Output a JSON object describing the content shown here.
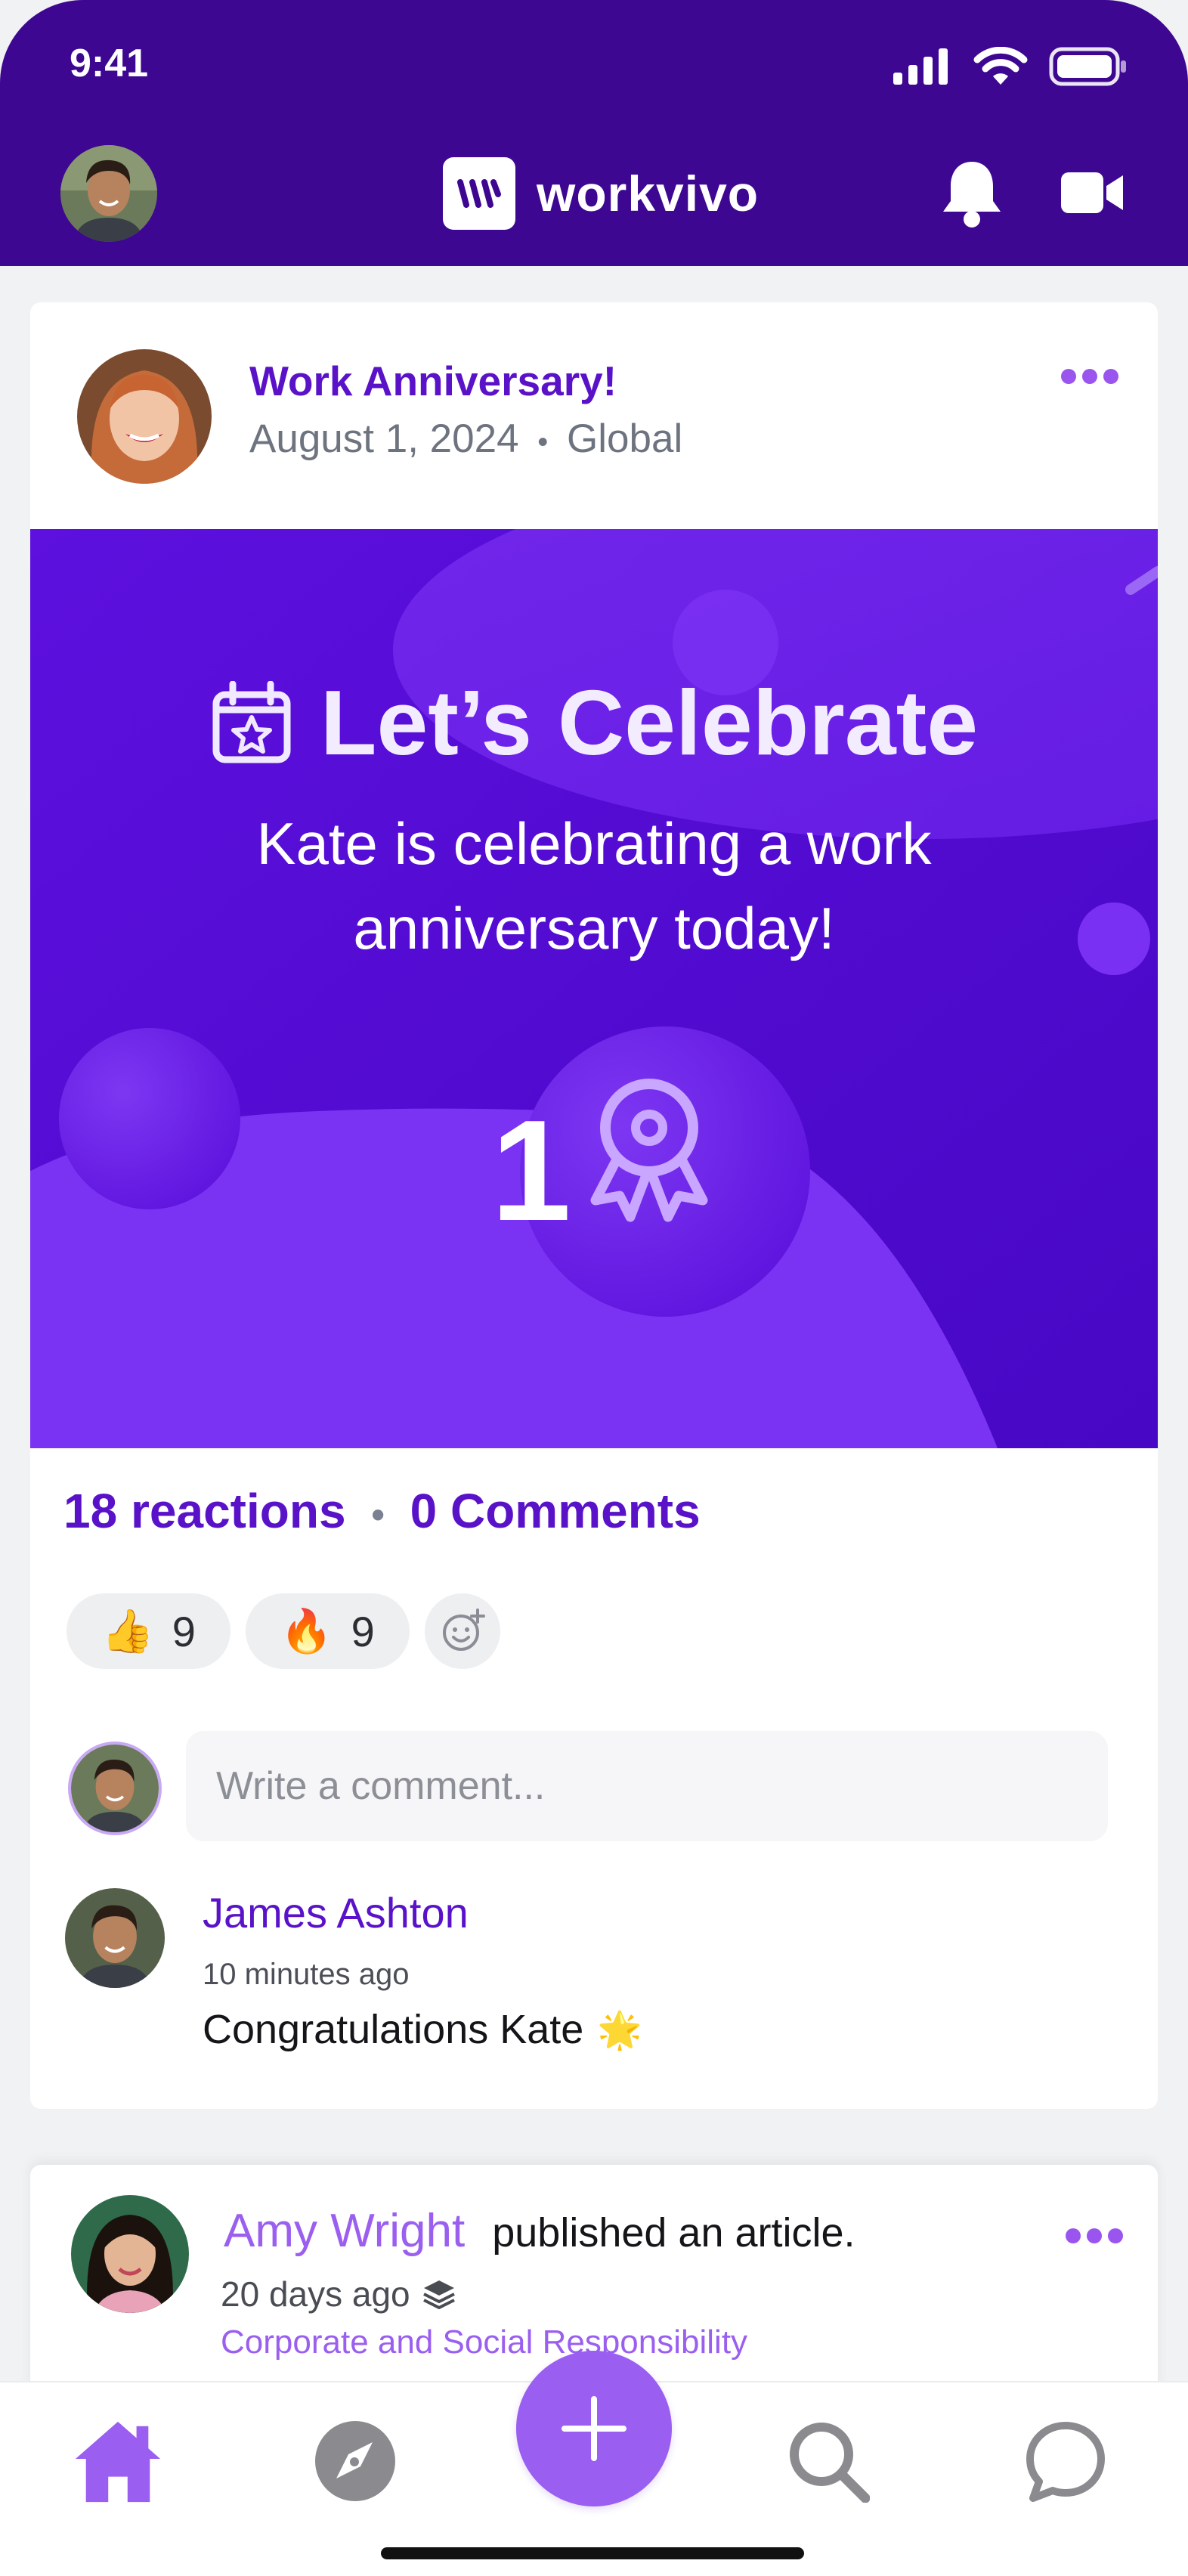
{
  "status_bar": {
    "time": "9:41"
  },
  "header": {
    "app_name": "workvivo",
    "logo_icon": "workvivo-logo-icon"
  },
  "post": {
    "title": "Work Anniversary!",
    "date": "August 1, 2024",
    "audience": "Global",
    "separator": "•",
    "banner": {
      "heading": "Let’s Celebrate",
      "message": "Kate is celebrating a work anniversary today!",
      "years": "1"
    },
    "reactions_count": "18 reactions",
    "comments_count": "0 Comments",
    "reactions": [
      {
        "emoji": "👍",
        "count": "9"
      },
      {
        "emoji": "🔥",
        "count": "9"
      }
    ],
    "comment_placeholder": "Write a comment...",
    "comment": {
      "author": "James Ashton",
      "time": "10 minutes ago",
      "text": "Congratulations Kate",
      "emoji": "🌟"
    }
  },
  "next_post": {
    "author": "Amy Wright",
    "action": "published an article.",
    "time": "20 days ago",
    "category": "Corporate and Social Responsibility"
  },
  "bottom_nav": [
    "home",
    "explore",
    "create",
    "search",
    "chat"
  ],
  "colors": {
    "header": "#3d0791",
    "primary_text": "#5a12c9",
    "accent": "#9a5ef0",
    "banner": "#4f0bd3"
  }
}
